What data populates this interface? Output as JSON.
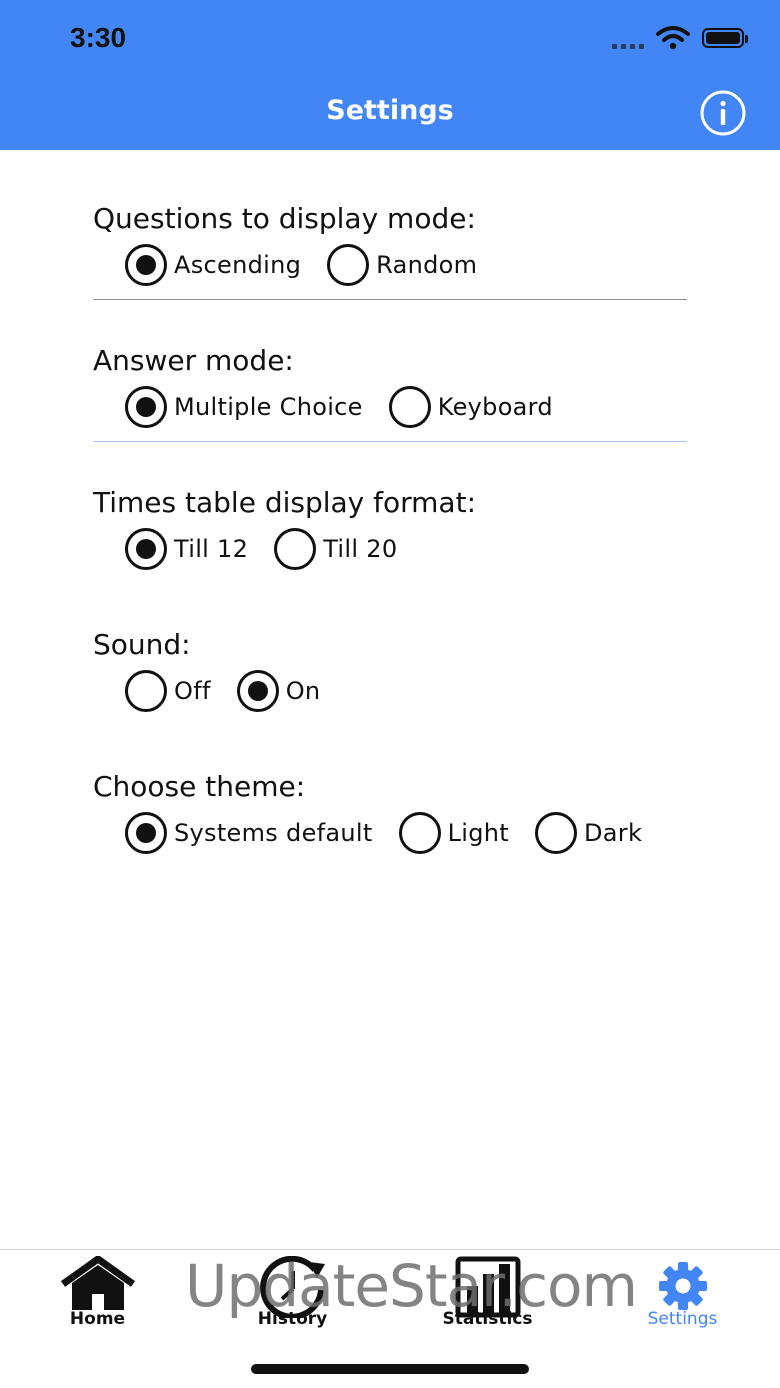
{
  "status_bar": {
    "time": "3:30"
  },
  "header": {
    "title": "Settings",
    "info_icon": "info-icon",
    "background_color": "#4285f4"
  },
  "sections": [
    {
      "label": "Questions to display mode:",
      "options": [
        {
          "label": "Ascending",
          "selected": true
        },
        {
          "label": "Random",
          "selected": false
        }
      ]
    },
    {
      "label": "Answer mode:",
      "options": [
        {
          "label": "Multiple Choice",
          "selected": true
        },
        {
          "label": "Keyboard",
          "selected": false
        }
      ]
    },
    {
      "label": "Times table display format:",
      "options": [
        {
          "label": "Till 12",
          "selected": true
        },
        {
          "label": "Till 20",
          "selected": false
        }
      ]
    },
    {
      "label": "Sound:",
      "options": [
        {
          "label": "Off",
          "selected": false
        },
        {
          "label": "On",
          "selected": true
        }
      ]
    },
    {
      "label": "Choose theme:",
      "options": [
        {
          "label": "Systems default",
          "selected": true
        },
        {
          "label": "Light",
          "selected": false
        },
        {
          "label": "Dark",
          "selected": false
        }
      ]
    }
  ],
  "dividers": {
    "first_color": "#8e8e8e",
    "second_color": "#a9c7e8"
  },
  "tab_bar": {
    "items": [
      {
        "label": "Home",
        "icon": "home-icon",
        "active": false
      },
      {
        "label": "History",
        "icon": "history-icon",
        "active": false
      },
      {
        "label": "Statistics",
        "icon": "statistics-icon",
        "active": false
      },
      {
        "label": "Settings",
        "icon": "gear-icon",
        "active": true
      }
    ],
    "active_color": "#4285f4"
  },
  "watermark": "UpdateStar.com"
}
